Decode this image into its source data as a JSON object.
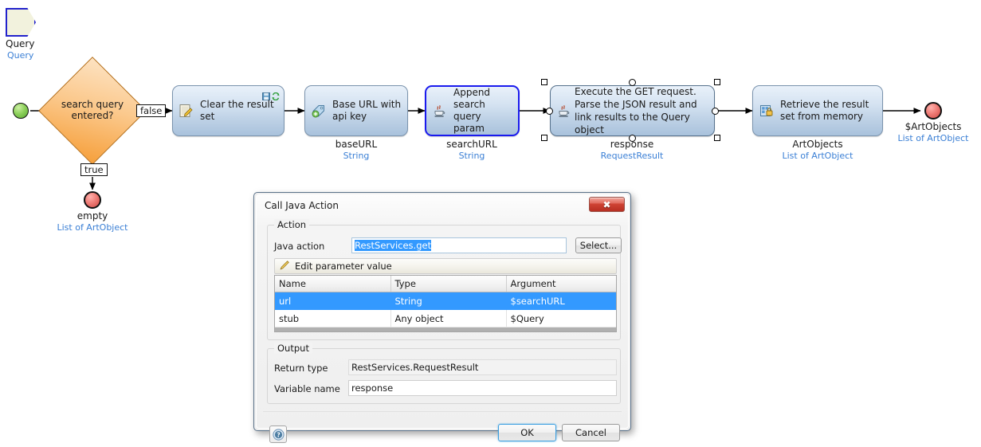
{
  "diagram": {
    "parameter": {
      "name": "Query",
      "type": "Query"
    },
    "decision": {
      "label_line1": "search query",
      "label_line2": "entered?",
      "true_label": "true",
      "false_label": "false"
    },
    "true_end": {
      "caption": "empty",
      "type": "List of ArtObject"
    },
    "final_end": {
      "caption": "$ArtObjects",
      "type": "List of ArtObject"
    },
    "activities": [
      {
        "text": "Clear the result set",
        "icon": "change-object-icon",
        "caption": "",
        "type": "",
        "badges": [
          "save-icon",
          "refresh-icon"
        ],
        "selected": false
      },
      {
        "text": "Base URL with api key",
        "icon": "create-variable-icon",
        "caption": "baseURL",
        "type": "String",
        "badges": [],
        "selected": false
      },
      {
        "text": "Append search query param",
        "icon": "java-action-icon",
        "caption": "searchURL",
        "type": "String",
        "badges": [],
        "selected": true
      },
      {
        "text": "Execute the GET request. Parse the JSON result and link results to the Query object",
        "icon": "java-action-icon",
        "caption": "response",
        "type": "RequestResult",
        "badges": [],
        "selected": false,
        "multiselected": true
      },
      {
        "text": "Retrieve the result set from memory",
        "icon": "retrieve-icon",
        "caption": "ArtObjects",
        "type": "List of ArtObject",
        "badges": [],
        "selected": false
      }
    ]
  },
  "dialog": {
    "title": "Call Java Action",
    "close_glyph": "✖",
    "action_group": {
      "legend": "Action",
      "java_action_label": "Java action",
      "java_action_value": "RestServices.get",
      "select_button": "Select..."
    },
    "toolbar": {
      "edit_parameter_label": "Edit parameter value",
      "pencil_icon": "pencil-icon"
    },
    "table": {
      "headers": [
        "Name",
        "Type",
        "Argument"
      ],
      "rows": [
        {
          "name": "url",
          "type": "String",
          "argument": "$searchURL",
          "selected": true
        },
        {
          "name": "stub",
          "type": "Any object",
          "argument": "$Query",
          "selected": false
        }
      ]
    },
    "output_group": {
      "legend": "Output",
      "return_type_label": "Return type",
      "return_type_value": "RestServices.RequestResult",
      "variable_name_label": "Variable name",
      "variable_name_value": "response"
    },
    "footer": {
      "help_glyph": "?",
      "ok_label": "OK",
      "cancel_label": "Cancel"
    }
  },
  "colors": {
    "accent_blue": "#3399ff",
    "selection_border": "#1a1aee",
    "type_text": "#3a7fd5",
    "decision_fill": "#f6a03c"
  }
}
